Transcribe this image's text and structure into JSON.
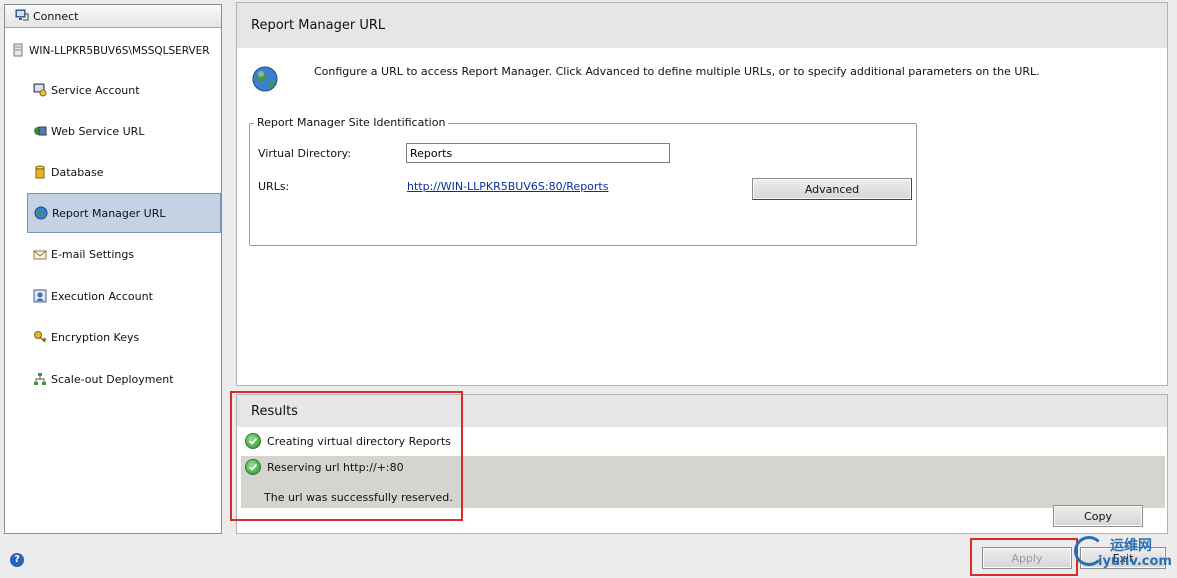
{
  "nav": {
    "connect_label": "Connect",
    "server_label": "WIN-LLPKR5BUV6S\\MSSQLSERVER",
    "items": [
      {
        "label": "Service Account",
        "icon": "service-account-icon"
      },
      {
        "label": "Web Service URL",
        "icon": "web-service-icon"
      },
      {
        "label": "Database",
        "icon": "database-icon"
      },
      {
        "label": "Report Manager URL",
        "icon": "globe-icon",
        "active": true
      },
      {
        "label": "E-mail Settings",
        "icon": "email-icon"
      },
      {
        "label": "Execution Account",
        "icon": "execution-account-icon"
      },
      {
        "label": "Encryption Keys",
        "icon": "key-icon"
      },
      {
        "label": "Scale-out Deployment",
        "icon": "scale-out-icon"
      }
    ]
  },
  "main": {
    "title": "Report Manager URL",
    "description": "Configure a URL to access Report Manager.  Click Advanced to define multiple URLs, or to specify additional parameters on the URL.",
    "group": {
      "legend": "Report Manager Site Identification",
      "virtual_directory_label": "Virtual Directory:",
      "virtual_directory_value": "Reports",
      "urls_label": "URLs:",
      "url_link": "http://WIN-LLPKR5BUV6S:80/Reports",
      "advanced_button": "Advanced"
    }
  },
  "results": {
    "title": "Results",
    "line1": "Creating virtual directory Reports",
    "line2": "Reserving url http://+:80",
    "line2_detail": "The url was successfully reserved.",
    "copy_button": "Copy"
  },
  "buttons": {
    "apply": "Apply",
    "exit": "Exit"
  },
  "watermark": {
    "line1": "运维网",
    "line2": "iyunv.com"
  },
  "colors": {
    "highlight_red": "#d62c2c",
    "active_nav_bg": "#c5d2e4",
    "link_blue": "#0a2f9c",
    "success_green": "#2d8d2d"
  }
}
